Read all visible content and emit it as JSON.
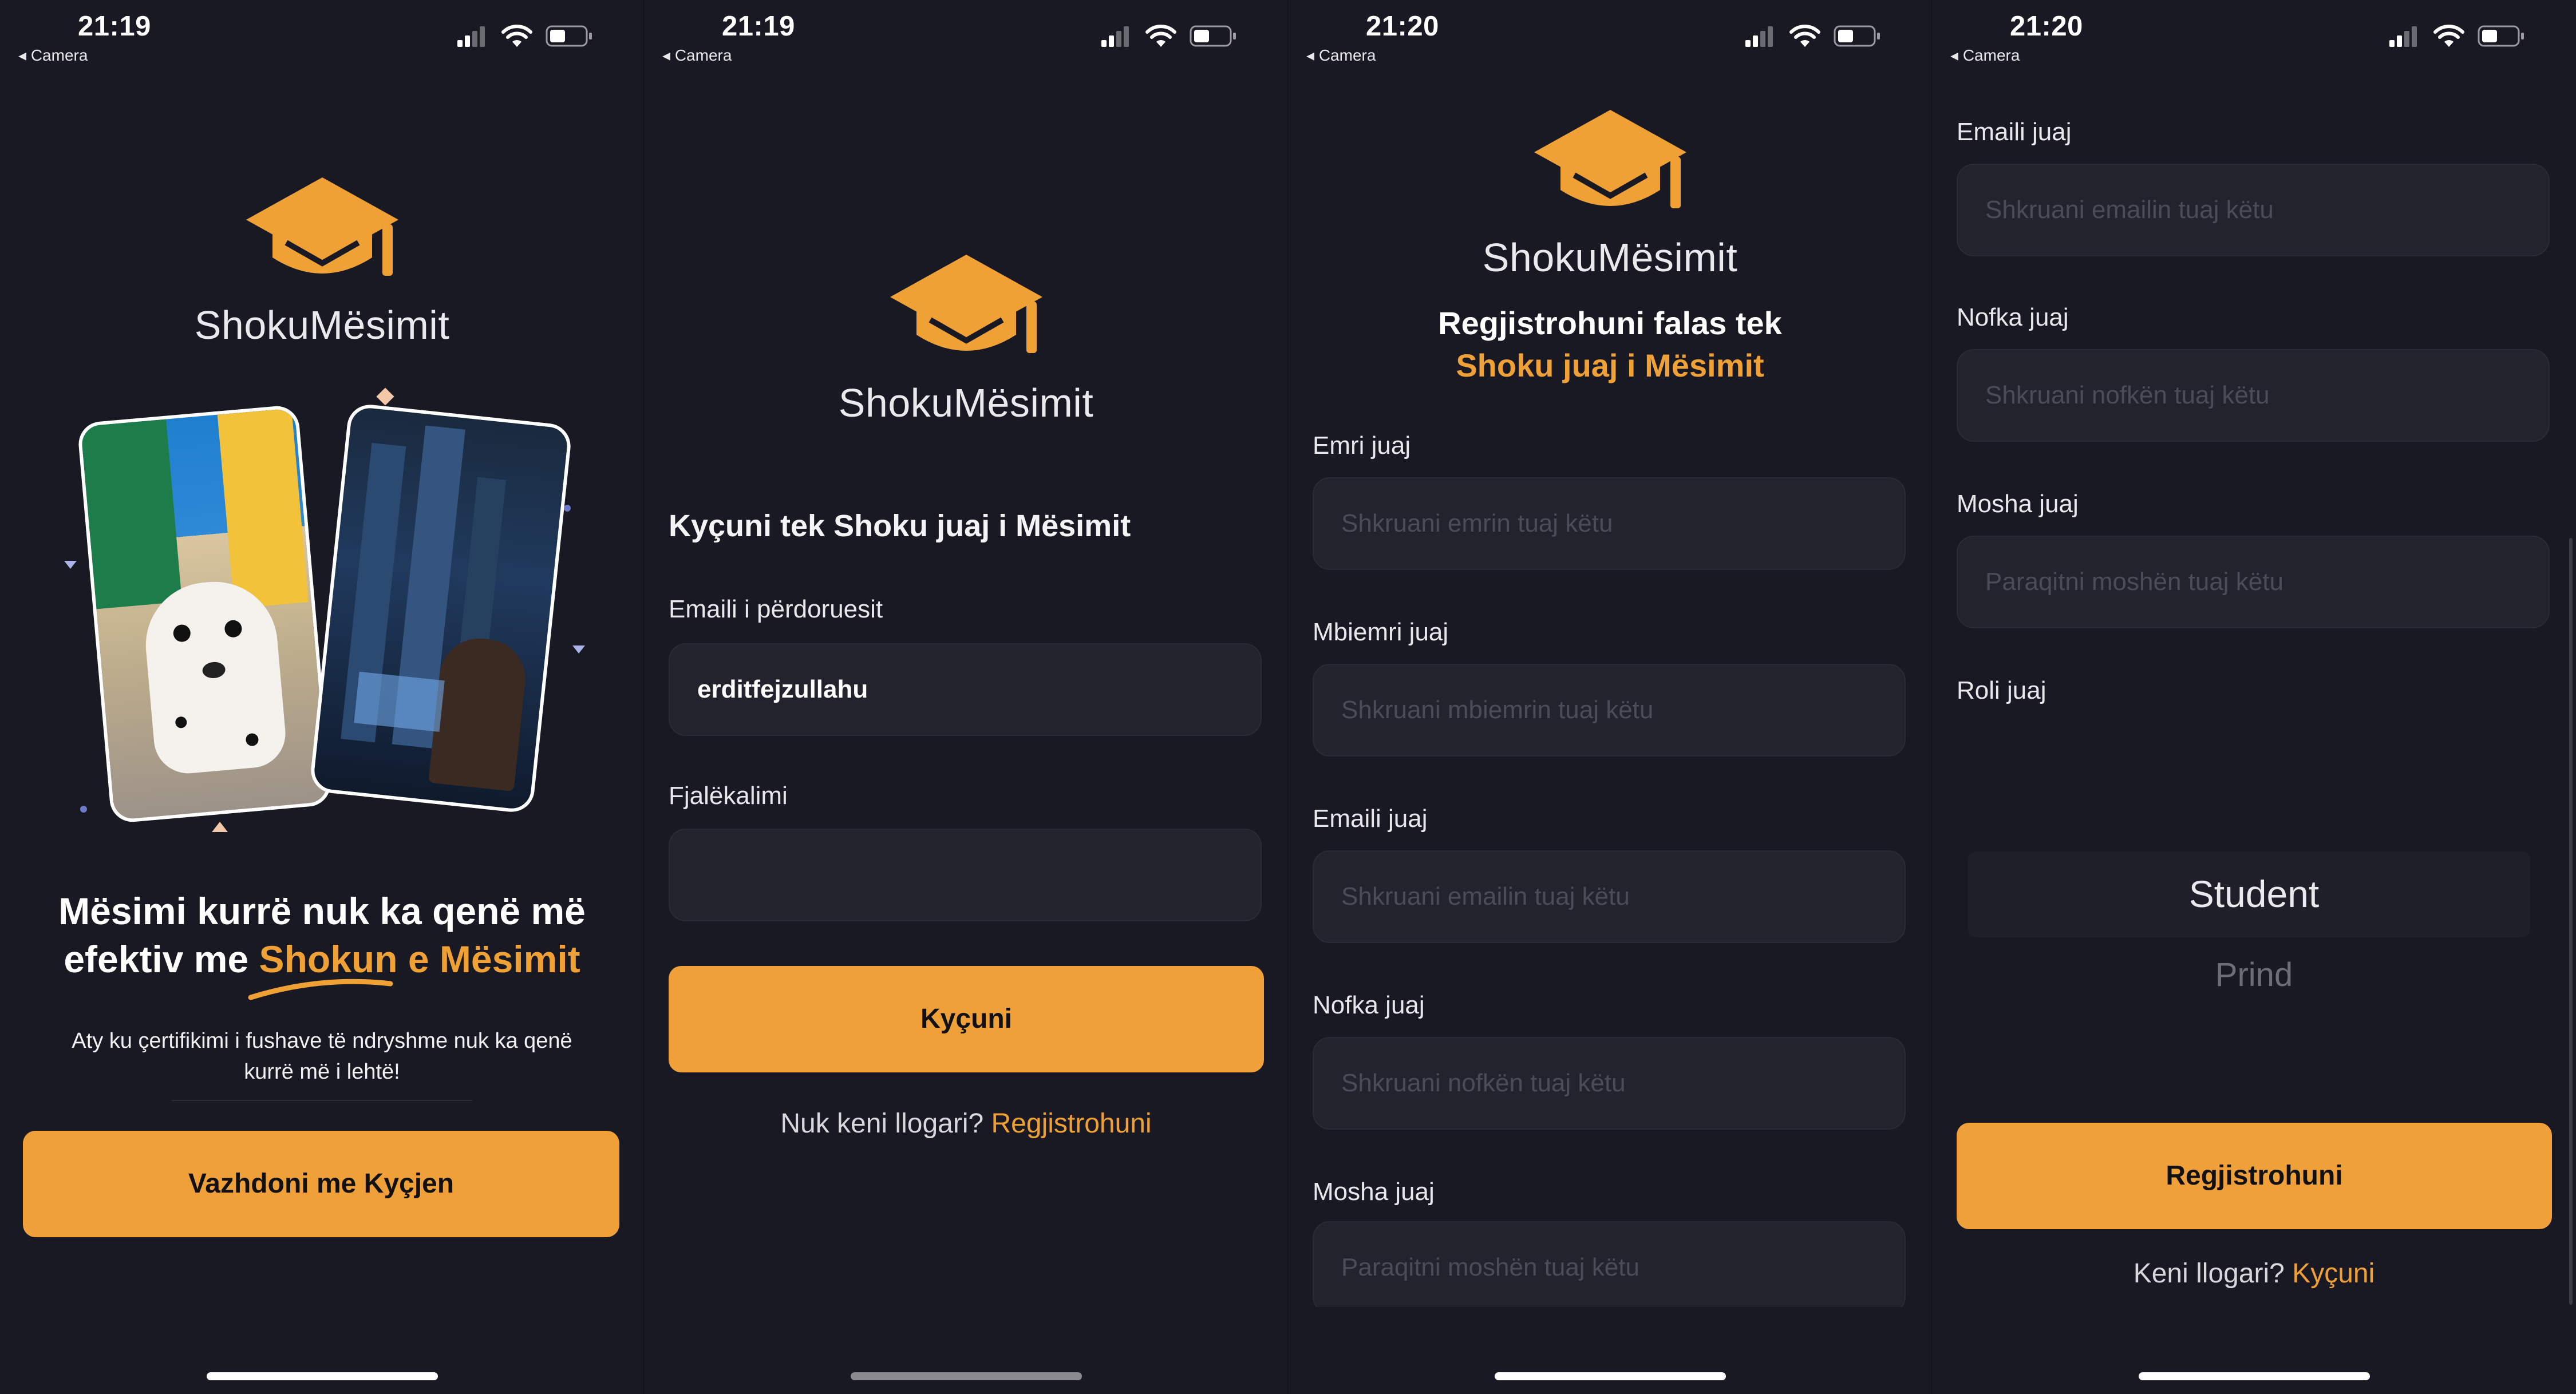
{
  "status_bar": [
    {
      "time": "21:19",
      "back": "◂ Camera"
    },
    {
      "time": "21:19",
      "back": "◂ Camera"
    },
    {
      "time": "21:20",
      "back": "◂ Camera"
    },
    {
      "time": "21:20",
      "back": "◂ Camera"
    }
  ],
  "brand": {
    "name": "ShokuMësimit",
    "accent": "#f0a136",
    "background": "#181922"
  },
  "welcome": {
    "title_line1": "Mësimi kurrë nuk ka qenë më",
    "title_line2_prefix": "efektiv me",
    "title_line2_highlight": "Shokun e Mësimit",
    "subtitle_line1": "Aty ku çertifikimi i fushave të ndryshme nuk ka qenë",
    "subtitle_line2": "kurrë më i lehtë!",
    "cta": "Vazhdoni me Kyçjen"
  },
  "login": {
    "heading": "Kyçuni tek Shoku juaj i Mësimit",
    "username_label": "Emaili i përdoruesit",
    "username_value": "erditfejzullahu",
    "password_label": "Fjalëkalimi",
    "password_value": "",
    "submit": "Kyçuni",
    "footer_text": "Nuk keni llogari?",
    "footer_link": "Regjistrohuni"
  },
  "register": {
    "title_line1": "Regjistrohuni falas tek",
    "title_line2": "Shoku juaj i Mësimit",
    "fields": [
      {
        "label": "Emri juaj",
        "placeholder": "Shkruani emrin tuaj këtu"
      },
      {
        "label": "Mbiemri juaj",
        "placeholder": "Shkruani mbiemrin tuaj këtu"
      },
      {
        "label": "Emaili juaj",
        "placeholder": "Shkruani emailin tuaj këtu"
      },
      {
        "label": "Nofka juaj",
        "placeholder": "Shkruani nofkën tuaj këtu"
      },
      {
        "label": "Mosha juaj",
        "placeholder": "Paraqitni moshën tuaj këtu"
      }
    ]
  },
  "register2": {
    "fields": [
      {
        "label": "Emaili juaj",
        "placeholder": "Shkruani emailin tuaj këtu"
      },
      {
        "label": "Nofka juaj",
        "placeholder": "Shkruani nofkën tuaj këtu"
      },
      {
        "label": "Mosha juaj",
        "placeholder": "Paraqitni moshën tuaj këtu"
      }
    ],
    "role_label": "Roli juaj",
    "role_options": [
      "Student",
      "Prind"
    ],
    "role_selected": "Student",
    "submit": "Regjistrohuni",
    "footer_text": "Keni llogari?",
    "footer_link": "Kyçuni"
  }
}
